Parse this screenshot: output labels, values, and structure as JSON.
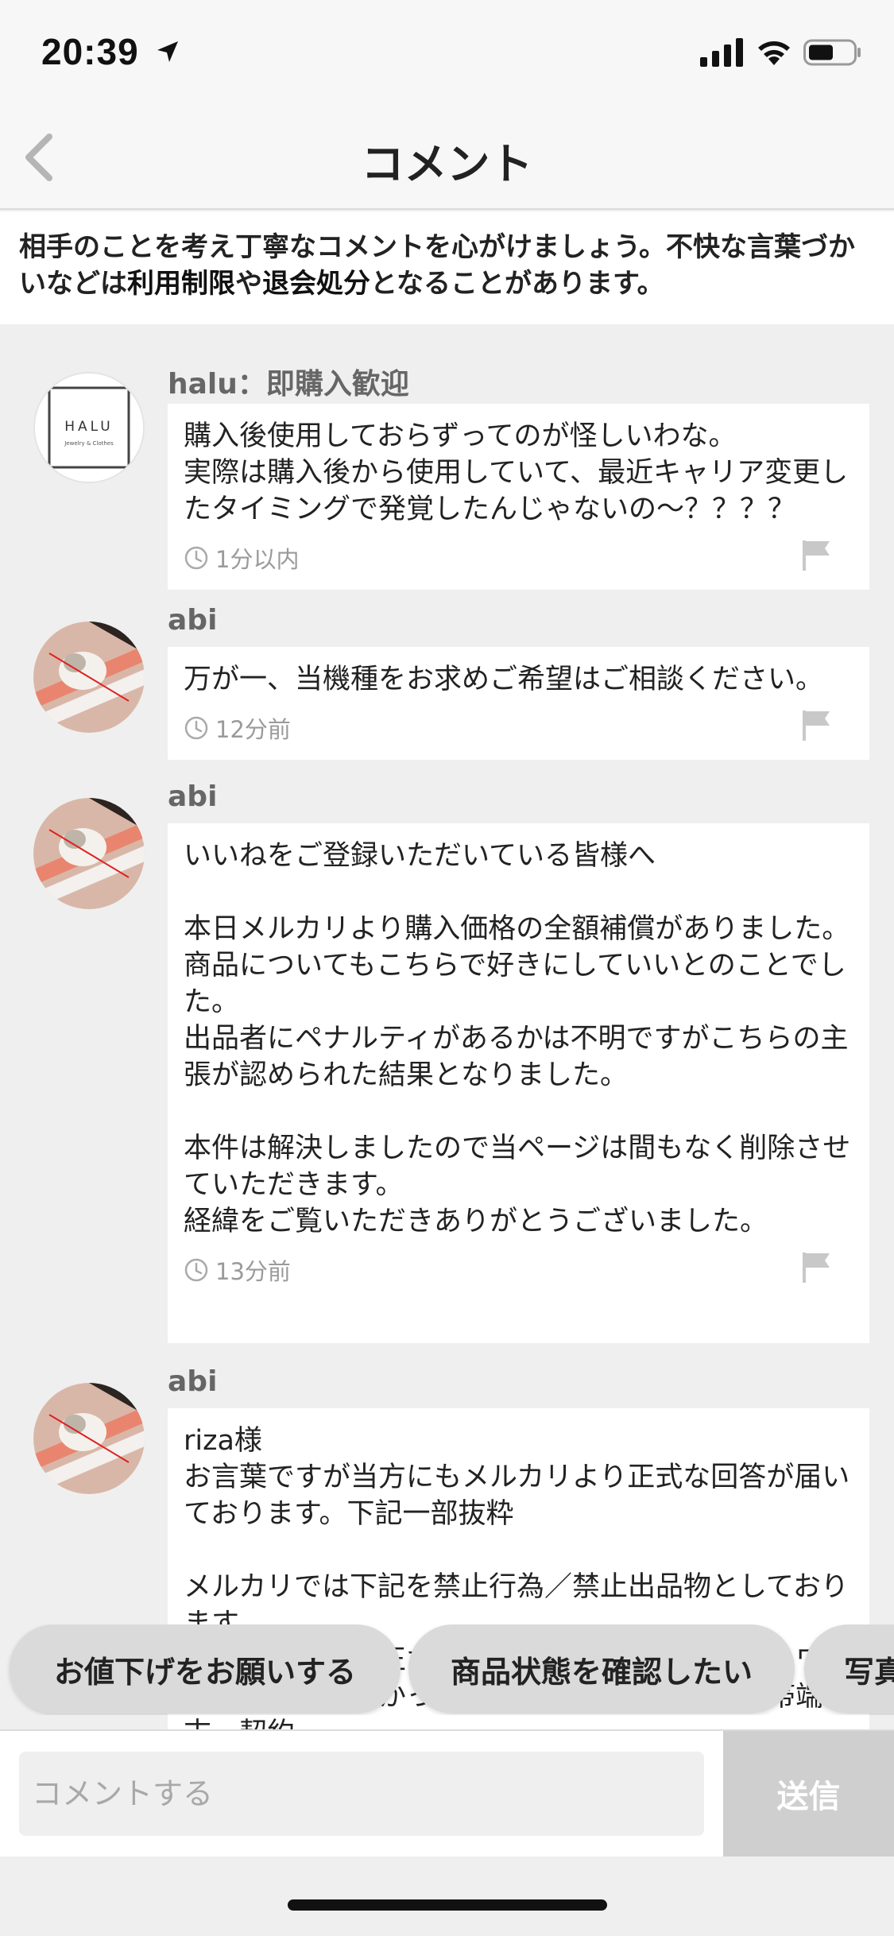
{
  "status_bar": {
    "time": "20:39"
  },
  "nav": {
    "title": "コメント"
  },
  "notice": {
    "part1": "相手のことを考え丁寧なコメントを心がけましょう。不快な言葉づかいなどは",
    "bold1": "利用制限",
    "part2": "や",
    "bold2": "退会処分",
    "part3": "となることがあります。"
  },
  "comments": [
    {
      "author": "halu：即購入歓迎",
      "avatar_text": "HALU",
      "avatar_sub": "Jewelry & Clothes",
      "body": "購入後使用しておらずってのが怪しいわな。\n実際は購入後から使用していて、最近キャリア変更したタイミングで発覚したんじゃないの〜？？？？",
      "time": "1分以内"
    },
    {
      "author": "abi",
      "body": "万が一、当機種をお求めご希望はご相談ください。",
      "time": "12分前"
    },
    {
      "author": "abi",
      "body": "いいねをご登録いただいている皆様へ\n\n本日メルカリより購入価格の全額補償がありました。\n商品についてもこちらで好きにしていいとのことでした。\n出品者にペナルティがあるかは不明ですがこちらの主張が認められた結果となりました。\n\n本件は解決しましたので当ページは間もなく削除させていただきます。\n経緯をご覧いただきありがとうございました。",
      "time": "13分前"
    },
    {
      "author": "abi",
      "body": "riza様\nお言葉ですが当方にもメルカリより正式な回答が届いております。下記一部抜粋\n\nメルカリでは下記を禁止行為／禁止出品物としております。\n・盗難品など不正な経路で入手した商品（ネットワーク利用制限のかかった携帯端末、残債がある携帯端末、契約"
    }
  ],
  "quick_replies": [
    "お値下げをお願いする",
    "商品状態を確認したい",
    "写真"
  ],
  "input": {
    "placeholder": "コメントする",
    "send_label": "送信"
  },
  "colors": {
    "background": "#efefef",
    "bubble": "#ffffff",
    "send_disabled": "#cfcfcf"
  }
}
